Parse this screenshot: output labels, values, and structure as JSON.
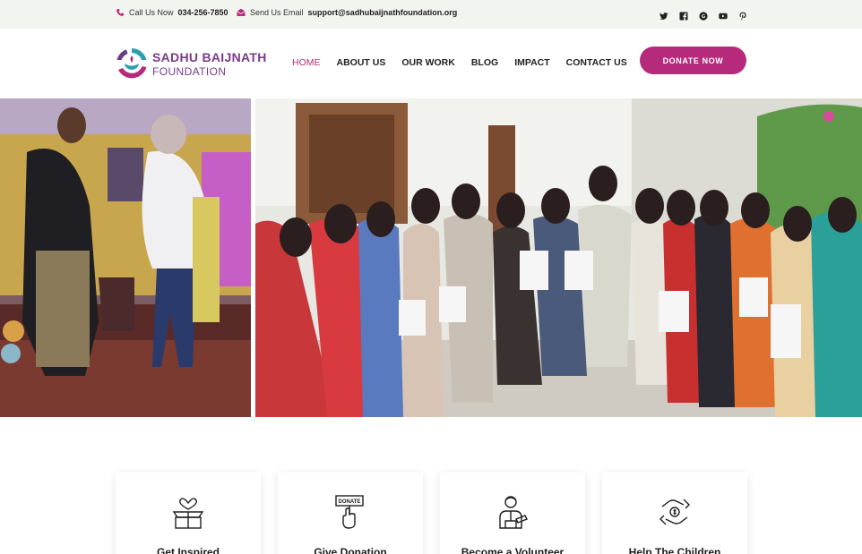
{
  "topbar": {
    "phone_prefix": "Call Us Now",
    "phone": "034-256-7850",
    "email_prefix": "Send Us Email",
    "email": "support@sadhubaijnathfoundation.org",
    "social_icons": [
      "twitter-icon",
      "facebook-icon",
      "google-plus-icon",
      "youtube-icon",
      "pinterest-icon"
    ]
  },
  "logo": {
    "line1": "SADHU BAIJNATH",
    "line2": "FOUNDATION"
  },
  "nav": {
    "items": [
      "HOME",
      "ABOUT US",
      "OUR WORK",
      "BLOG",
      "IMPACT",
      "CONTACT US"
    ],
    "active": "HOME"
  },
  "donate_button": "DONATE NOW",
  "cards": [
    {
      "title": "Get Inspired",
      "icon": "gift-box-heart-icon"
    },
    {
      "title": "Give Donation",
      "icon": "donate-hand-icon"
    },
    {
      "title": "Become a Volunteer",
      "icon": "volunteer-icon"
    },
    {
      "title": "Help The Children",
      "icon": "helping-hands-icon"
    }
  ],
  "colors": {
    "accent": "#b52a7a",
    "nav_active": "#b0307a",
    "topbar_bg": "#f2f4f0",
    "logo_text": "#7a3a8a"
  }
}
